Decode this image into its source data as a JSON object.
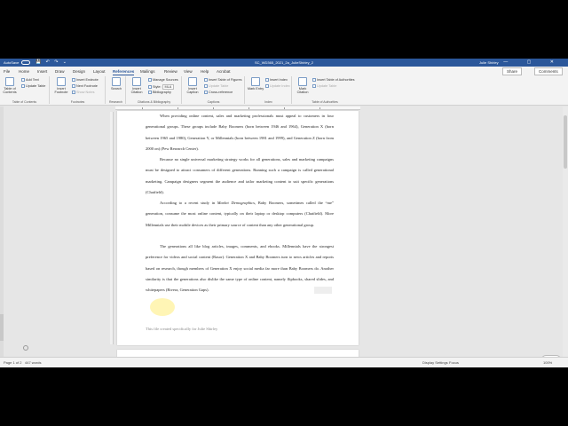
{
  "titlebar": {
    "autosave": "AutoSave",
    "toggle": "Off",
    "qat": "💾 ↶ ↷ ⌄",
    "doctitle": "SC_WD365_2021_2a_JulieShirley_2",
    "user": "Julie Shirley",
    "window_controls": "— ▢ ✕"
  },
  "tabs": {
    "items": [
      "File",
      "Home",
      "Insert",
      "Draw",
      "Design",
      "Layout",
      "References",
      "Mailings",
      "Review",
      "View",
      "Help",
      "Acrobat"
    ],
    "active": "References",
    "share": "Share",
    "comments": "Comments"
  },
  "ribbon": {
    "toc": {
      "table_of_contents": "Table of Contents",
      "add_text": "Add Text",
      "update_table": "Update Table",
      "label": "Table of Contents"
    },
    "footnotes": {
      "insert_footnote": "Insert Footnote",
      "insert_endnote": "Insert Endnote",
      "next_footnote": "Next Footnote",
      "show_notes": "Show Notes",
      "label": "Footnotes"
    },
    "research": {
      "search": "Search",
      "label": "Research"
    },
    "citations": {
      "insert_citation": "Insert Citation",
      "manage_sources": "Manage Sources",
      "style_label": "Style:",
      "style_value": "MLA",
      "bibliography": "Bibliography",
      "label": "Citations & Bibliography"
    },
    "captions": {
      "insert_caption": "Insert Caption",
      "insert_table_of_figures": "Insert Table of Figures",
      "update_table": "Update Table",
      "cross_reference": "Cross-reference",
      "label": "Captions"
    },
    "index": {
      "mark_entry": "Mark Entry",
      "insert_index": "Insert Index",
      "update_index": "Update Index",
      "label": "Index"
    },
    "authorities": {
      "mark_citation": "Mark Citation",
      "insert_table_of_authorities": "Insert Table of Authorities",
      "update_table": "Update Table",
      "label": "Table of Authorities"
    }
  },
  "document": {
    "p1": "When providing online content, sales and marketing professionals must appeal to customers in four generational groups. These groups include Baby Boomers (born between 1946 and 1964), Generation X (born between 1965 and 1980), Generation Y, or Millennials (born between 1981 and 1999), and Generation Z (born from 2000 on) (Pew Research Center).",
    "p2": "Because no single universal marketing strategy works for all generations, sales and marketing campaigns must be designed to attract consumers of different generations. Running such a campaign is called generational marketing. Campaign designers segment the audience and tailor marketing content to suit specific generations (Chatfield).",
    "p3_before": "According to a recent study in ",
    "p3_italic": "Market Demographics",
    "p3_after": ", Baby Boomers, sometimes called the “me” generation, consume the most online content, typically on their laptop or desktop computers (Chatfield). More Millennials use their mobile devices as their primary source of content than any other generational group.",
    "p4": "The generations all like blog articles, images, comments, and ebooks. Millennials have the strongest preference for videos and social content (Rasor). Generation X and Baby Boomers turn to news articles and reports based on research, though members of Generation X enjoy social media far more than Baby Boomers do. Another similarity is that the generations also dislike the same type of online content, namely flipbooks, shared slides, and whitepapers",
    "p4_citation": "(Rivera, Generation Gaps).",
    "footer_note": "This file created specifically for Julie Shirley"
  },
  "statusbar": {
    "page": "Page 1 of 2",
    "words": "447 words",
    "display_settings": "Display Settings",
    "focus": "Focus",
    "zoom": "100%"
  },
  "badge": {
    "count": "2"
  }
}
